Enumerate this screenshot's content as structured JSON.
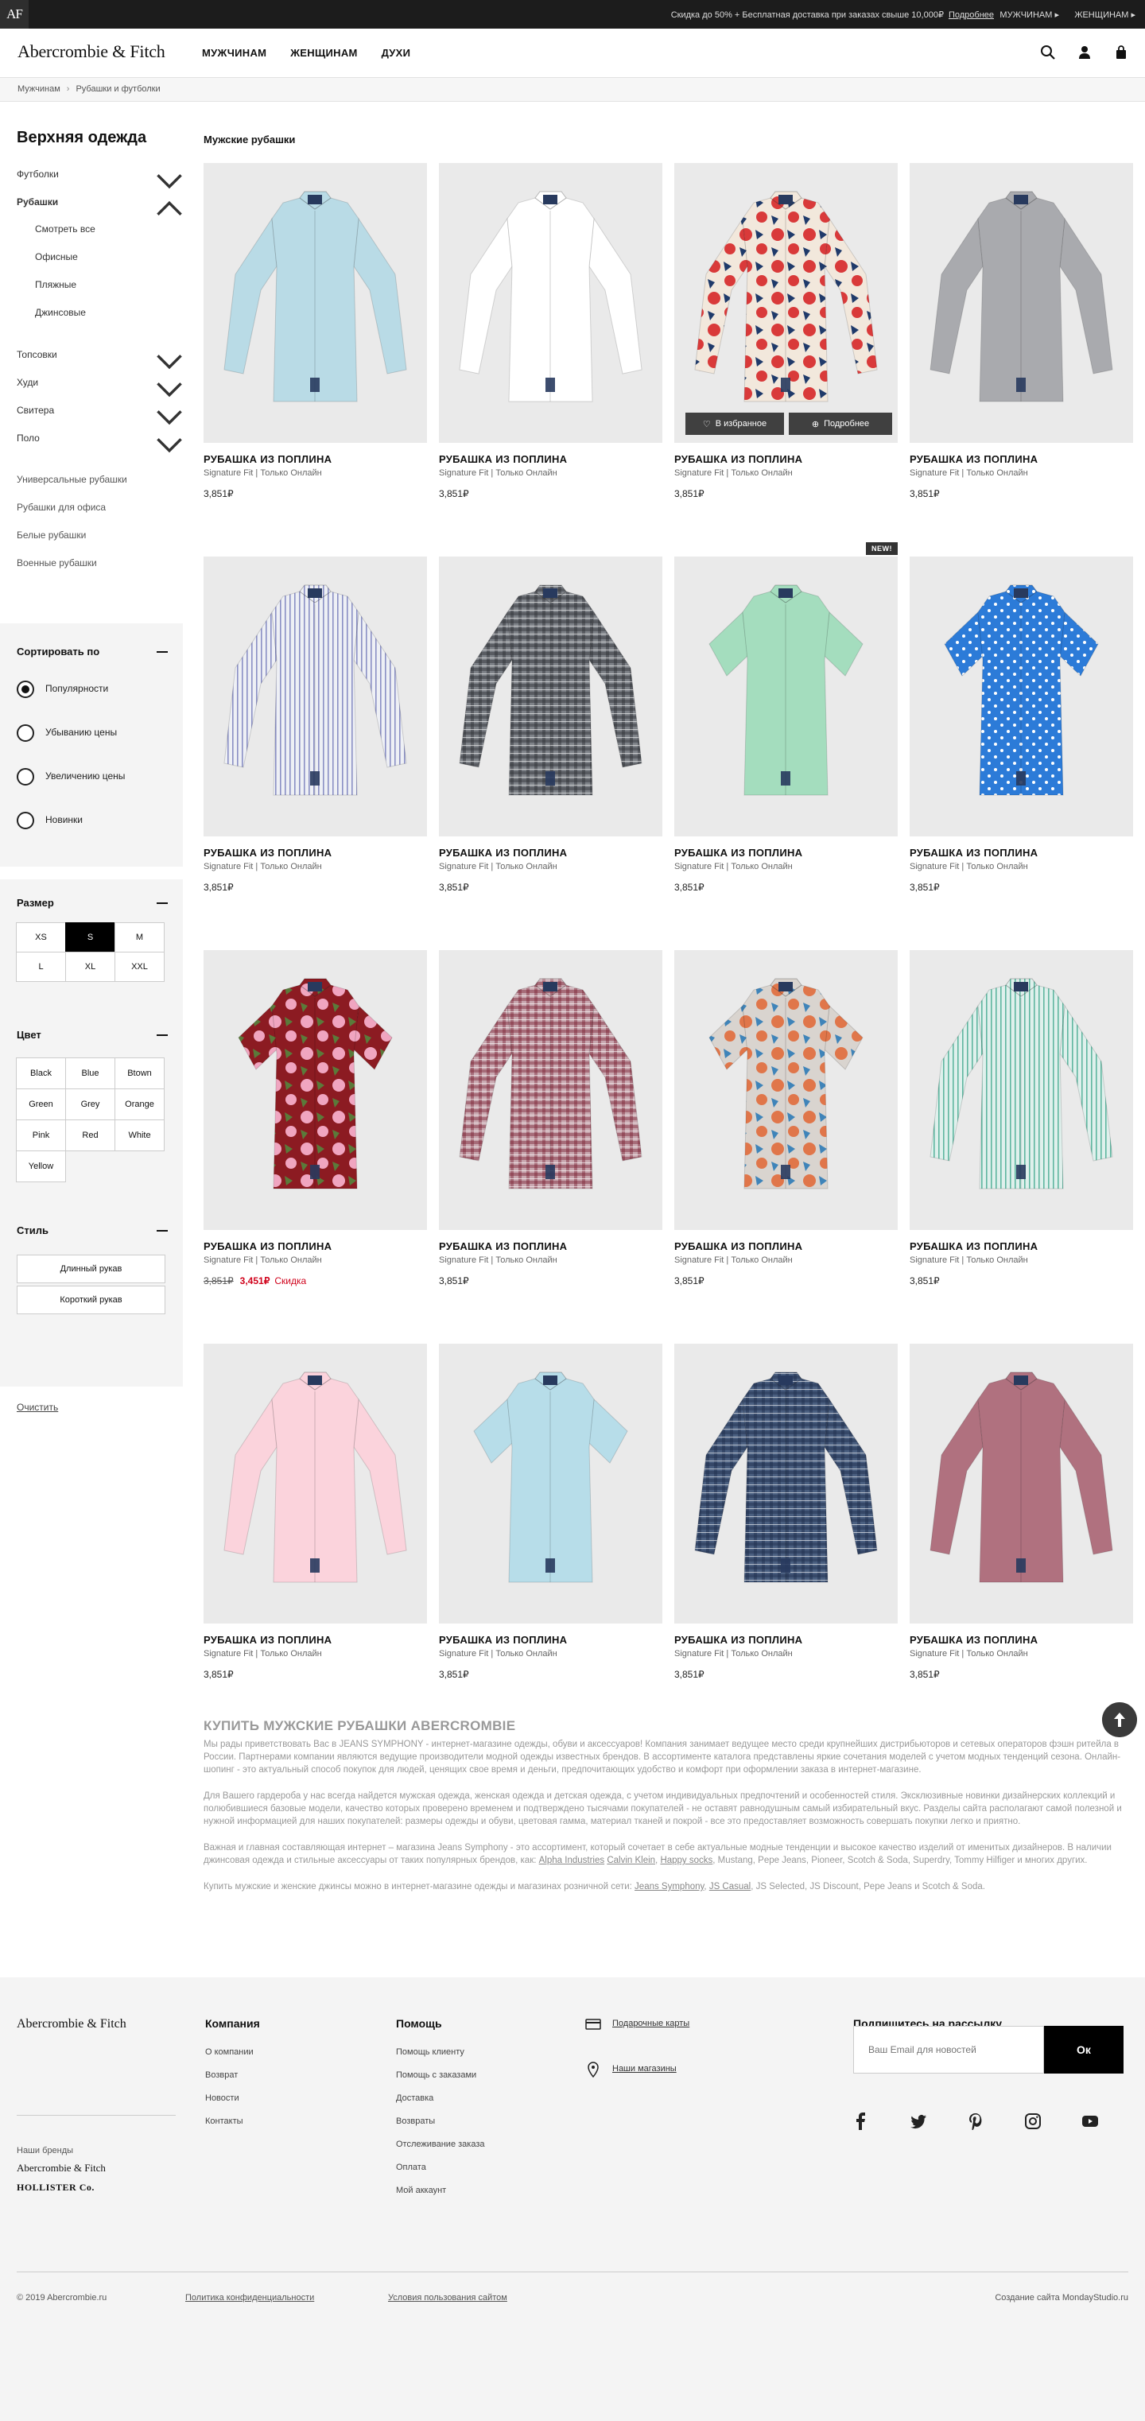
{
  "topbar": {
    "monogram": "AF",
    "promo": "Скидка до 50% + Бесплатная доставка при заказах свыше 10,000₽",
    "promo_link": "Подробнее",
    "men": "МУЖЧИНАМ",
    "women": "ЖЕНЩИНАМ"
  },
  "header": {
    "logo": "Abercrombie & Fitch",
    "nav": [
      "МУЖЧИНАМ",
      "ЖЕНЩИНАМ",
      "ДУХИ"
    ]
  },
  "breadcrumb": [
    "Мужчинам",
    "Рубашки и футболки"
  ],
  "sidebar": {
    "title": "Верхняя одежда",
    "categories": [
      {
        "label": "Футболки",
        "state": "collapsed"
      },
      {
        "label": "Рубашки",
        "state": "expanded"
      },
      {
        "label": "Топсовки",
        "state": "collapsed"
      },
      {
        "label": "Худи",
        "state": "collapsed"
      },
      {
        "label": "Свитера",
        "state": "collapsed"
      },
      {
        "label": "Поло",
        "state": "collapsed"
      }
    ],
    "subcategories": [
      "Смотреть все",
      "Офисные",
      "Пляжные",
      "Джинсовые"
    ],
    "links": [
      "Универсальные рубашки",
      "Рубашки для офиса",
      "Белые рубашки",
      "Военные рубашки"
    ],
    "sort": {
      "title": "Сортировать по",
      "options": [
        "Популярности",
        "Убыванию цены",
        "Увеличению цены",
        "Новинки"
      ],
      "selected": "Популярности"
    },
    "size": {
      "title": "Размер",
      "options": [
        "XS",
        "S",
        "M",
        "L",
        "XL",
        "XXL"
      ],
      "selected": "S"
    },
    "color": {
      "title": "Цвет",
      "options": [
        "Black",
        "Blue",
        "Btown",
        "Green",
        "Grey",
        "Orange",
        "Pink",
        "Red",
        "White",
        "Yellow"
      ]
    },
    "style": {
      "title": "Стиль",
      "options": [
        "Длинный рукав",
        "Короткий рукав"
      ]
    },
    "clear": "Очистить"
  },
  "page_title": "Мужские рубашки",
  "products": [
    {
      "name": "РУБАШКА ИЗ ПОПЛИНА",
      "sub": "Signature Fit | Только Онлайн",
      "price": "3,851₽",
      "shirt": "#b9dbe6",
      "pattern": "solid"
    },
    {
      "name": "РУБАШКА ИЗ ПОПЛИНА",
      "sub": "Signature Fit | Только Онлайн",
      "price": "3,851₽",
      "shirt": "#ffffff",
      "pattern": "solid"
    },
    {
      "name": "РУБАШКА ИЗ ПОПЛИНА",
      "sub": "Signature Fit | Только Онлайн",
      "price": "3,851₽",
      "shirt": "#f2e8dc",
      "pattern": "floral-red",
      "hover": true
    },
    {
      "name": "РУБАШКА ИЗ ПОПЛИНА",
      "sub": "Signature Fit | Только Онлайн",
      "price": "3,851₽",
      "shirt": "#a9aaae",
      "pattern": "solid"
    },
    {
      "name": "РУБАШКА ИЗ ПОПЛИНА",
      "sub": "Signature Fit | Только Онлайн",
      "price": "3,851₽",
      "shirt": "#eef0f5",
      "pattern": "stripe-lilac"
    },
    {
      "name": "РУБАШКА ИЗ ПОПЛИНА",
      "sub": "Signature Fit | Только Онлайн",
      "price": "3,851₽",
      "shirt": "#7e8288",
      "pattern": "plaid-grey"
    },
    {
      "name": "РУБАШКА ИЗ ПОПЛИНА",
      "sub": "Signature Fit | Только Онлайн",
      "price": "3,851₽",
      "shirt": "#a4ddbe",
      "pattern": "solid-short",
      "badge": "NEW!"
    },
    {
      "name": "РУБАШКА ИЗ ПОПЛИНА",
      "sub": "Signature Fit | Только Онлайн",
      "price": "3,851₽",
      "shirt": "#2c7bd8",
      "pattern": "dots-short"
    },
    {
      "name": "РУБАШКА ИЗ ПОПЛИНА",
      "sub": "Signature Fit | Только Онлайн",
      "price": "3,851₽",
      "old_price": "3,851₽",
      "sale_price": "3,451₽",
      "sale_label": "Скидка",
      "shirt": "#8c1b22",
      "pattern": "floral-pink-short"
    },
    {
      "name": "РУБАШКА ИЗ ПОПЛИНА",
      "sub": "Signature Fit | Только Онлайн",
      "price": "3,851₽",
      "shirt": "#c9a8b0",
      "pattern": "plaid-red"
    },
    {
      "name": "РУБАШКА ИЗ ПОПЛИНА",
      "sub": "Signature Fit | Только Онлайн",
      "price": "3,851₽",
      "shirt": "#d9d4cf",
      "pattern": "floral-multi-short"
    },
    {
      "name": "РУБАШКА ИЗ ПОПЛИНА",
      "sub": "Signature Fit | Только Онлайн",
      "price": "3,851₽",
      "shirt": "#dff0ec",
      "pattern": "stripe-mint"
    },
    {
      "name": "РУБАШКА ИЗ ПОПЛИНА",
      "sub": "Signature Fit | Только Онлайн",
      "price": "3,851₽",
      "shirt": "#fbd3dc",
      "pattern": "solid"
    },
    {
      "name": "РУБАШКА ИЗ ПОПЛИНА",
      "sub": "Signature Fit | Только Онлайн",
      "price": "3,851₽",
      "shirt": "#b7dde9",
      "pattern": "solid-short"
    },
    {
      "name": "РУБАШКА ИЗ ПОПЛИНА",
      "sub": "Signature Fit | Только Онлайн",
      "price": "3,851₽",
      "shirt": "#4a5f80",
      "pattern": "plaid-blue"
    },
    {
      "name": "РУБАШКА ИЗ ПОПЛИНА",
      "sub": "Signature Fit | Только Онлайн",
      "price": "3,851₽",
      "shirt": "#b0717f",
      "pattern": "solid"
    }
  ],
  "card_actions": {
    "favorite": "В избранное",
    "details": "Подробнее"
  },
  "seo": {
    "title": "КУПИТЬ МУЖСКИЕ РУБАШКИ ABERCROMBIE",
    "p1": "Мы рады приветствовать Вас в JEANS SYMPHONY - интернет-магазине одежды, обуви и аксессуаров! Компания занимает ведущее место среди крупнейших дистрибьюторов и сетевых операторов фэшн ритейла в России. Партнерами компании являются ведущие производители модной одежды известных брендов. В ассортименте каталога представлены яркие сочетания моделей с учетом модных тенденций сезона. Онлайн-шопинг - это актуальный способ покупок для людей, ценящих свое время и деньги, предпочитающих удобство и комфорт при оформлении заказа в интернет-магазине.",
    "p2": "Для Вашего гардероба у нас всегда найдется мужская одежда, женская одежда и детская одежда, с учетом индивидуальных предпочтений и особенностей стиля. Эксклюзивные новинки дизайнерских коллекций и полюбившиеся базовые модели, качество которых проверено временем и подтверждено тысячами покупателей - не оставят равнодушным самый избирательный вкус. Разделы сайта располагают самой полезной и нужной информацией для наших покупателей: размеры одежды и обуви, цветовая гамма, материал тканей и покрой - все это предоставляет возможность совершать покупки легко и приятно.",
    "p3_a": "Важная и главная составляющая интернет – магазина Jeans Symphony - это ассортимент, который сочетает в себе актуальные модные тенденции и высокое качество изделий от именитых дизайнеров. В наличии джинсовая одежда и стильные аксессуары от таких популярных брендов, как:",
    "p3_l1": "Alpha Industries",
    "p3_l2": "Calvin Klein",
    "p3_l3": "Happy socks",
    "p3_b": ", Mustang, Pepe Jeans, Pioneer, Scotch & Soda, Superdry, Tommy Hilfiger и многих других.",
    "p4_a": "Купить мужские и женские джинсы можно в интернет-магазине одежды и магазинах розничной сети:",
    "p4_l1": "Jeans Symphony",
    "p4_l2": "JS Casual",
    "p4_b": ", JS Selected, JS Discount, Pepe Jeans и Scotch & Soda."
  },
  "footer": {
    "logo": "Abercrombie & Fitch",
    "brands_title": "Наши бренды",
    "brand1": "Abercrombie & Fitch",
    "brand2": "HOLLISTER Co.",
    "company": {
      "title": "Компания",
      "links": [
        "О компании",
        "Возврат",
        "Новости",
        "Контакты"
      ]
    },
    "help": {
      "title": "Помощь",
      "links": [
        "Помощь клиенту",
        "Помощь с заказами",
        "Доставка",
        "Возвраты",
        "Отслеживание заказа",
        "Оплата",
        "Мой аккаунт"
      ]
    },
    "gift_cards": "Подарочные карты",
    "stores": "Наши магазины",
    "subscribe_title": "Подпишитесь на рассылку",
    "email_placeholder": "Ваш Email для новостей",
    "subscribe_button": "Ок",
    "social": [
      "facebook-icon",
      "twitter-icon",
      "pinterest-icon",
      "instagram-icon",
      "youtube-icon"
    ],
    "copyright": "© 2019 Abercrombie.ru",
    "privacy": "Политика конфиденциальности",
    "terms": "Условия пользования сайтом",
    "credit": "Создание сайта MondayStudio.ru"
  }
}
